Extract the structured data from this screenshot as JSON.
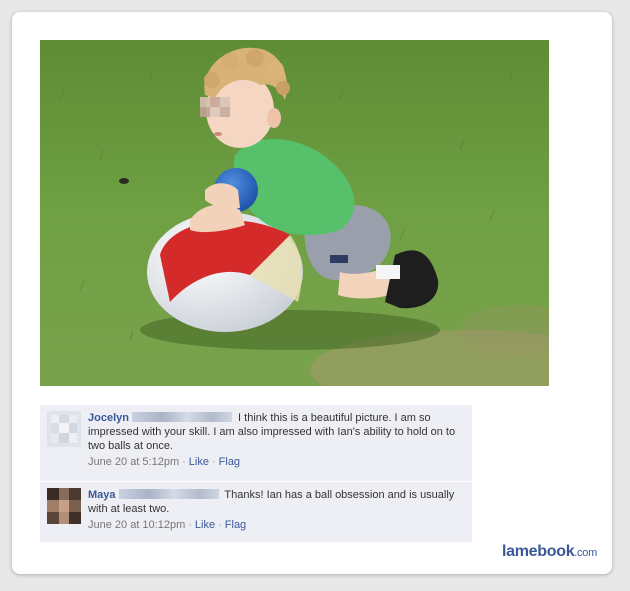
{
  "post": {
    "photo_alt": "child-with-beach-ball-photo"
  },
  "comments": [
    {
      "author": "Jocelyn",
      "text": "I think this is a beautiful picture. I am so impressed with your skill. I am also impressed with Ian's ability to hold on to two balls at once.",
      "timestamp": "June 20 at 5:12pm",
      "like_label": "Like",
      "flag_label": "Flag"
    },
    {
      "author": "Maya",
      "text": "Thanks! Ian has a ball obsession and is usually with at least two.",
      "timestamp": "June 20 at 10:12pm",
      "like_label": "Like",
      "flag_label": "Flag"
    }
  ],
  "brand": {
    "name": "lamebook",
    "domain": ".com"
  },
  "colors": {
    "link": "#3b5998",
    "comment_bg": "#edeff4",
    "grass": "#6b9a3f"
  }
}
